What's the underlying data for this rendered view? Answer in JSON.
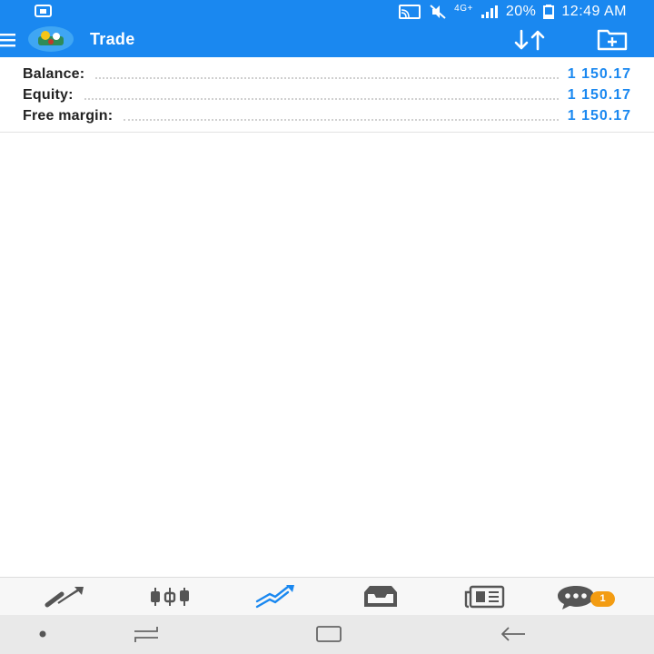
{
  "status_bar": {
    "battery": "20%",
    "time": "12:49 AM",
    "network": "4G+"
  },
  "app_bar": {
    "title": "Trade",
    "icons": [
      "menu-icon",
      "app-logo",
      "sort-icon",
      "new-order-icon"
    ]
  },
  "account": {
    "rows": [
      {
        "label": "Balance:",
        "value": "1 150.17"
      },
      {
        "label": "Equity:",
        "value": "1 150.17"
      },
      {
        "label": "Free margin:",
        "value": "1 150.17"
      }
    ]
  },
  "bottom_nav": {
    "items": [
      "quotes-icon",
      "chart-icon",
      "trade-icon",
      "history-icon",
      "news-icon",
      "messages-icon"
    ],
    "active": "trade-icon",
    "messages_badge": "1"
  },
  "colors": {
    "accent": "#1a88f0",
    "badge": "#f39c12",
    "icon_gray": "#555555"
  }
}
